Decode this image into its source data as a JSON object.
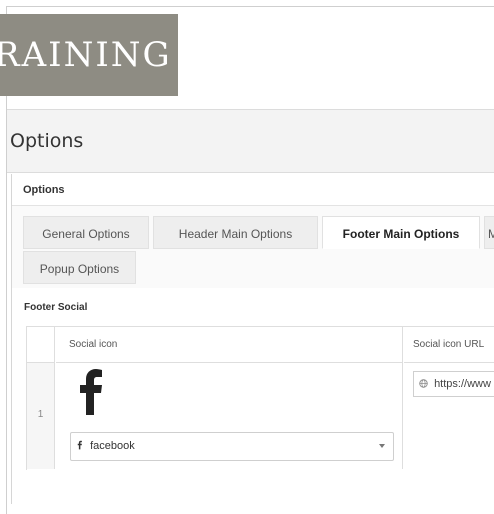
{
  "brand": {
    "logo_text": "RAINING"
  },
  "page": {
    "title": "Options"
  },
  "panel": {
    "title": "Options"
  },
  "tabs": [
    {
      "label": "General Options",
      "active": false
    },
    {
      "label": "Header Main Options",
      "active": false
    },
    {
      "label": "Footer Main Options",
      "active": true
    },
    {
      "label": "M",
      "active": false
    },
    {
      "label": "Popup Options",
      "active": false
    }
  ],
  "section": {
    "label": "Footer Social"
  },
  "table": {
    "headers": [
      "Social icon",
      "Social icon URL"
    ],
    "rows": [
      {
        "index": "1",
        "icon_select": "facebook",
        "url": "https://www"
      }
    ]
  },
  "icons": {
    "row_icon": "facebook-icon",
    "url_icon": "globe-icon",
    "dropdown": "chevron-down-icon"
  },
  "colors": {
    "logo_bg": "#8e8c83",
    "panel_bg": "#f3f3f3",
    "active_tab_bg": "#ffffff"
  }
}
